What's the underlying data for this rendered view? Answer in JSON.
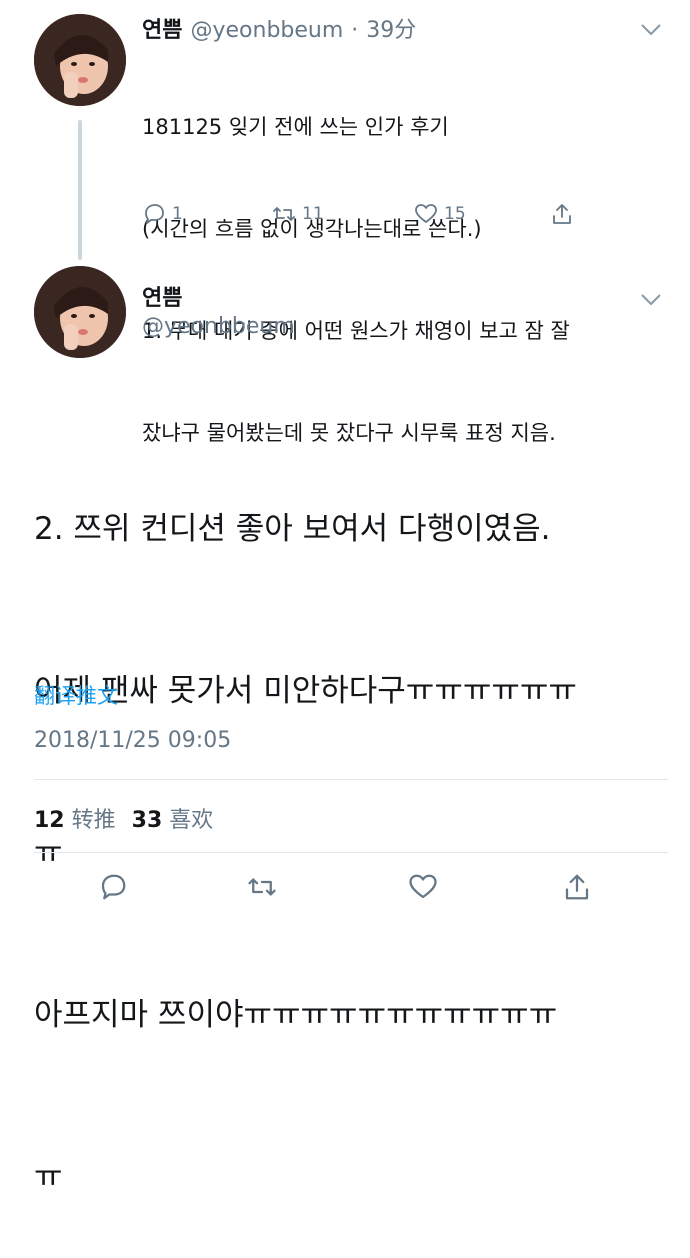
{
  "tweet1": {
    "display_name": "연쁨",
    "handle": "@yeonbbeum",
    "separator": "·",
    "time": "39分",
    "lines": [
      "181125 잊기 전에 쓰는 인가 후기",
      "(시간의 흐름 없이 생각나는대로 쓴다.)",
      "1. 무대 대기 중에 어떤 원스가 채영이 보고 잠 잘",
      "잤냐구 물어봤는데 못 잤다구 시무룩 표정 지음."
    ],
    "reply_count": "1",
    "retweet_count": "11",
    "like_count": "15"
  },
  "tweet2": {
    "display_name": "연쁨",
    "handle": "@yeonbbeum",
    "lines": [
      "2. 쯔위 컨디션 좋아 보여서 다행이였음.",
      "어제 팬싸 못가서 미안하다구ㅠㅠㅠㅠㅠㅠ",
      "ㅠ",
      "아프지마 쯔이야ㅠㅠㅠㅠㅠㅠㅠㅠㅠㅠㅠ",
      "ㅠ"
    ],
    "translate_label": "翻译推文",
    "timestamp": "2018/11/25 09:05",
    "retweets_num": "12",
    "retweets_label": "转推",
    "likes_num": "33",
    "likes_label": "喜欢"
  },
  "colors": {
    "accent": "#1da1f2",
    "text": "#14171a",
    "secondary": "#657786",
    "divider": "#e1e8ed"
  },
  "icons": [
    "avatar",
    "chevron-down-icon",
    "reply-icon",
    "retweet-icon",
    "heart-icon",
    "share-icon"
  ]
}
